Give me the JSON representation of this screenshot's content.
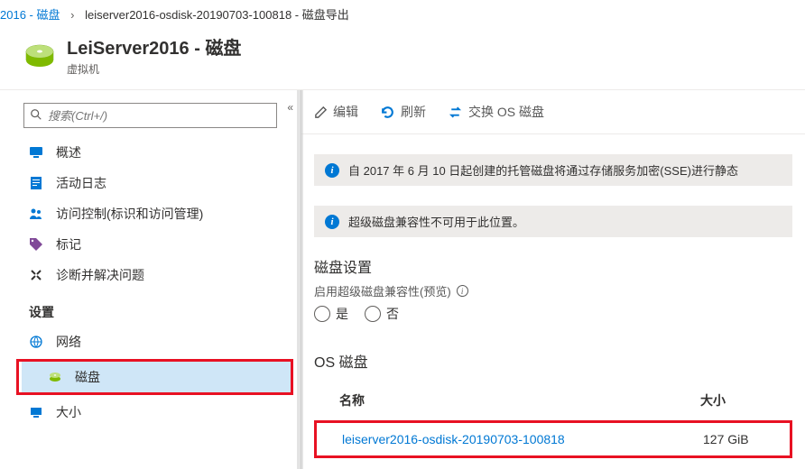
{
  "breadcrumb": {
    "link1": "2016 - 磁盘",
    "current": "leiserver2016-osdisk-20190703-100818 - 磁盘导出"
  },
  "header": {
    "title": "LeiServer2016 - 磁盘",
    "subtitle": "虚拟机"
  },
  "search": {
    "placeholder": "搜索(Ctrl+/)"
  },
  "nav": {
    "overview": "概述",
    "activity": "活动日志",
    "iam": "访问控制(标识和访问管理)",
    "tags": "标记",
    "diagnose": "诊断并解决问题",
    "group_settings": "设置",
    "network": "网络",
    "disks": "磁盘",
    "size": "大小"
  },
  "toolbar": {
    "edit": "编辑",
    "refresh": "刷新",
    "swap": "交换 OS 磁盘"
  },
  "info1": "自 2017 年 6 月 10 日起创建的托管磁盘将通过存储服务加密(SSE)进行静态",
  "info2": "超级磁盘兼容性不可用于此位置。",
  "sections": {
    "disk_settings": "磁盘设置",
    "ultra_label": "启用超级磁盘兼容性(预览)",
    "yes": "是",
    "no": "否",
    "os_disk": "OS 磁盘"
  },
  "table": {
    "col_name": "名称",
    "col_size": "大小",
    "row_name": "leiserver2016-osdisk-20190703-100818",
    "row_size": "127 GiB"
  }
}
